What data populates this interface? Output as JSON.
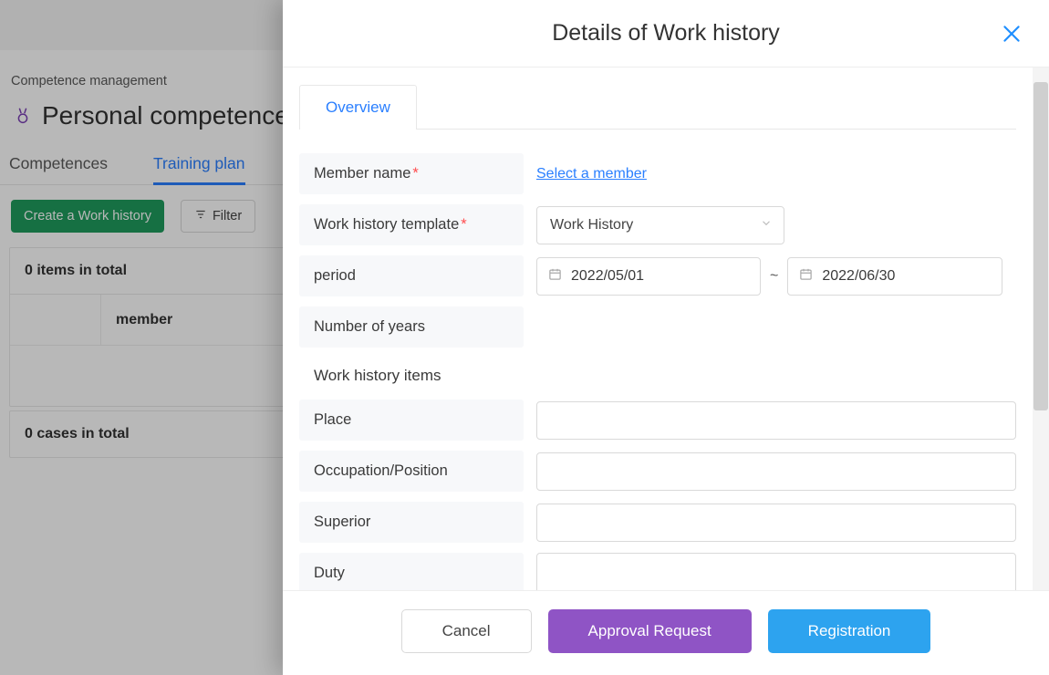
{
  "breadcrumb": "Competence management",
  "page_title": "Personal competence",
  "tabs": {
    "competences": "Competences",
    "training_plan": "Training plan"
  },
  "actions": {
    "create_work_history": "Create a Work history",
    "filter": "Filter"
  },
  "list": {
    "total_items": "0 items in total",
    "columns": {
      "member": "member"
    },
    "total_cases": "0 cases in total"
  },
  "drawer": {
    "title": "Details of Work history",
    "tab_overview": "Overview",
    "labels": {
      "member_name": "Member name",
      "work_history_template": "Work history template",
      "period": "period",
      "number_of_years": "Number of years",
      "work_history_items": "Work history items",
      "place": "Place",
      "occupation_position": "Occupation/Position",
      "superior": "Superior",
      "duty": "Duty"
    },
    "values": {
      "select_member_action": "Select a member",
      "template_selected": "Work History",
      "period_from": "2022/05/01",
      "period_to": "2022/06/30",
      "period_separator": "~",
      "number_of_years": "",
      "place": "",
      "occupation_position": "",
      "superior": "",
      "duty": ""
    },
    "footer": {
      "cancel": "Cancel",
      "approval_request": "Approval Request",
      "registration": "Registration"
    }
  }
}
